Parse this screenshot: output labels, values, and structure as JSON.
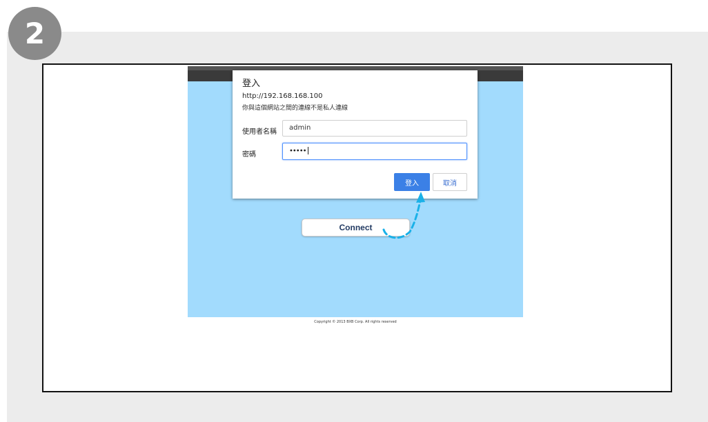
{
  "step": {
    "number": "2"
  },
  "dialog": {
    "title": "登入",
    "url": "http://192.168.168.100",
    "warning": "你與這個網站之間的連線不是私人連線",
    "username_label": "使用者名稱",
    "username_value": "admin",
    "password_label": "密碼",
    "password_value": "•••••",
    "login_button": "登入",
    "cancel_button": "取消"
  },
  "app": {
    "connect_button": "Connect",
    "copyright": "Copyright © 2013 BXB Corp. All rights reserved",
    "background_color": "#a2dbfd",
    "arrow_color": "#1ab1e8"
  }
}
